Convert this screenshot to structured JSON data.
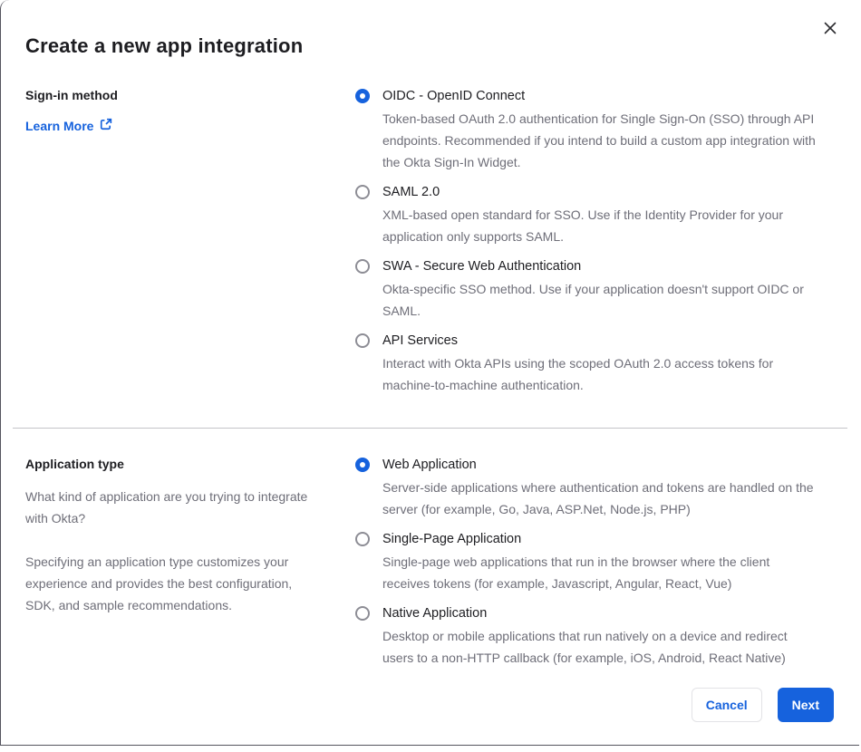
{
  "dialog": {
    "title": "Create a new app integration",
    "close_icon": "x"
  },
  "signin": {
    "heading": "Sign-in method",
    "learn_more_label": "Learn More",
    "options": [
      {
        "label": "OIDC - OpenID Connect",
        "description": "Token-based OAuth 2.0 authentication for Single Sign-On (SSO) through API endpoints. Recommended if you intend to build a custom app integration with the Okta Sign-In Widget.",
        "selected": true
      },
      {
        "label": "SAML 2.0",
        "description": "XML-based open standard for SSO. Use if the Identity Provider for your application only supports SAML.",
        "selected": false
      },
      {
        "label": "SWA - Secure Web Authentication",
        "description": "Okta-specific SSO method. Use if your application doesn't support OIDC or SAML.",
        "selected": false
      },
      {
        "label": "API Services",
        "description": "Interact with Okta APIs using the scoped OAuth 2.0 access tokens for machine-to-machine authentication.",
        "selected": false
      }
    ]
  },
  "apptype": {
    "heading": "Application type",
    "paragraph1": "What kind of application are you trying to integrate with Okta?",
    "paragraph2": "Specifying an application type customizes your experience and provides the best configuration, SDK, and sample recommendations.",
    "options": [
      {
        "label": "Web Application",
        "description": "Server-side applications where authentication and tokens are handled on the server (for example, Go, Java, ASP.Net, Node.js, PHP)",
        "selected": true
      },
      {
        "label": "Single-Page Application",
        "description": "Single-page web applications that run in the browser where the client receives tokens (for example, Javascript, Angular, React, Vue)",
        "selected": false
      },
      {
        "label": "Native Application",
        "description": "Desktop or mobile applications that run natively on a device and redirect users to a non-HTTP callback (for example, iOS, Android, React Native)",
        "selected": false
      }
    ]
  },
  "footer": {
    "cancel_label": "Cancel",
    "next_label": "Next"
  },
  "colors": {
    "primary_blue": "#1662dd",
    "text_dark": "#1d1d21",
    "text_gray": "#6e6e78",
    "divider_gray": "#c4c4c8"
  }
}
